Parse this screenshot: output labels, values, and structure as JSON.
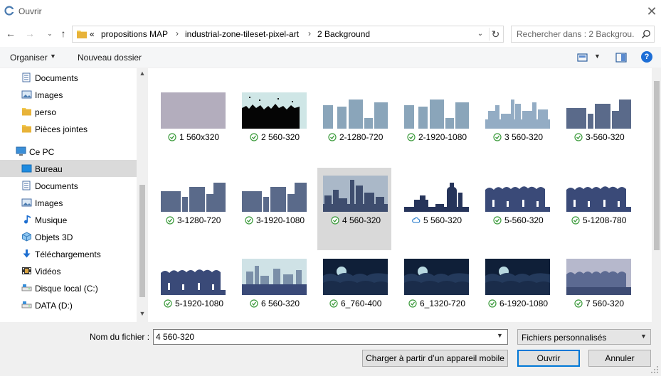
{
  "window": {
    "title": "Ouvrir"
  },
  "nav": {
    "breadcrumbs": [
      "propositions MAP",
      "industrial-zone-tileset-pixel-art",
      "2 Background"
    ],
    "overflow_marker": "«"
  },
  "search": {
    "placeholder": "Rechercher dans : 2 Backgrou..."
  },
  "toolbar": {
    "organize_label": "Organiser",
    "new_folder_label": "Nouveau dossier"
  },
  "sidebar": {
    "items": [
      {
        "label": "Documents",
        "icon": "documents-icon"
      },
      {
        "label": "Images",
        "icon": "images-icon"
      },
      {
        "label": "perso",
        "icon": "folder-icon"
      },
      {
        "label": "Pièces jointes",
        "icon": "folder-icon"
      },
      {
        "label": "Ce PC",
        "icon": "pc-icon"
      },
      {
        "label": "Bureau",
        "icon": "desktop-icon",
        "selected": true
      },
      {
        "label": "Documents",
        "icon": "documents-icon"
      },
      {
        "label": "Images",
        "icon": "images-icon"
      },
      {
        "label": "Musique",
        "icon": "music-icon"
      },
      {
        "label": "Objets 3D",
        "icon": "objects3d-icon"
      },
      {
        "label": "Téléchargements",
        "icon": "downloads-icon"
      },
      {
        "label": "Vidéos",
        "icon": "videos-icon"
      },
      {
        "label": "Disque local (C:)",
        "icon": "drive-icon"
      },
      {
        "label": "DATA (D:)",
        "icon": "drive-icon"
      }
    ]
  },
  "files": [
    {
      "name": "1 560x320",
      "status": "synced",
      "thumb": "flat"
    },
    {
      "name": "2 560-320",
      "status": "synced",
      "thumb": "bush"
    },
    {
      "name": "2-1280-720",
      "status": "synced",
      "thumb": "blocks-light"
    },
    {
      "name": "2-1920-1080",
      "status": "synced",
      "thumb": "blocks-light"
    },
    {
      "name": "3 560-320",
      "status": "synced",
      "thumb": "factory-light"
    },
    {
      "name": "3-560-320",
      "status": "synced",
      "thumb": "blocks-dark"
    },
    {
      "name": "3-1280-720",
      "status": "synced",
      "thumb": "blocks-dark"
    },
    {
      "name": "3-1920-1080",
      "status": "synced",
      "thumb": "blocks-dark"
    },
    {
      "name": "4 560-320",
      "status": "synced",
      "thumb": "factory-dark",
      "selected": true
    },
    {
      "name": "5 560-320",
      "status": "cloud",
      "thumb": "refinery"
    },
    {
      "name": "5-560-320",
      "status": "synced",
      "thumb": "trees"
    },
    {
      "name": "5-1208-780",
      "status": "synced",
      "thumb": "trees"
    },
    {
      "name": "5-1920-1080",
      "status": "synced",
      "thumb": "trees"
    },
    {
      "name": "6 560-320",
      "status": "synced",
      "thumb": "factory-teal"
    },
    {
      "name": "6_760-400",
      "status": "synced",
      "thumb": "night"
    },
    {
      "name": "6_1320-720",
      "status": "synced",
      "thumb": "night"
    },
    {
      "name": "6-1920-1080",
      "status": "synced",
      "thumb": "night"
    },
    {
      "name": "7 560-320",
      "status": "synced",
      "thumb": "trees-dusk"
    }
  ],
  "footer": {
    "filename_label": "Nom du fichier :",
    "filename_value": "4 560-320",
    "filetype_value": "Fichiers personnalisés",
    "mobile_button": "Charger à partir d’un appareil mobile",
    "open_button": "Ouvrir",
    "cancel_button": "Annuler"
  },
  "colors": {
    "accent": "#0078d7",
    "selection": "#d9d9d9",
    "synced": "#3a9a3a",
    "cloud": "#1a73c8"
  }
}
